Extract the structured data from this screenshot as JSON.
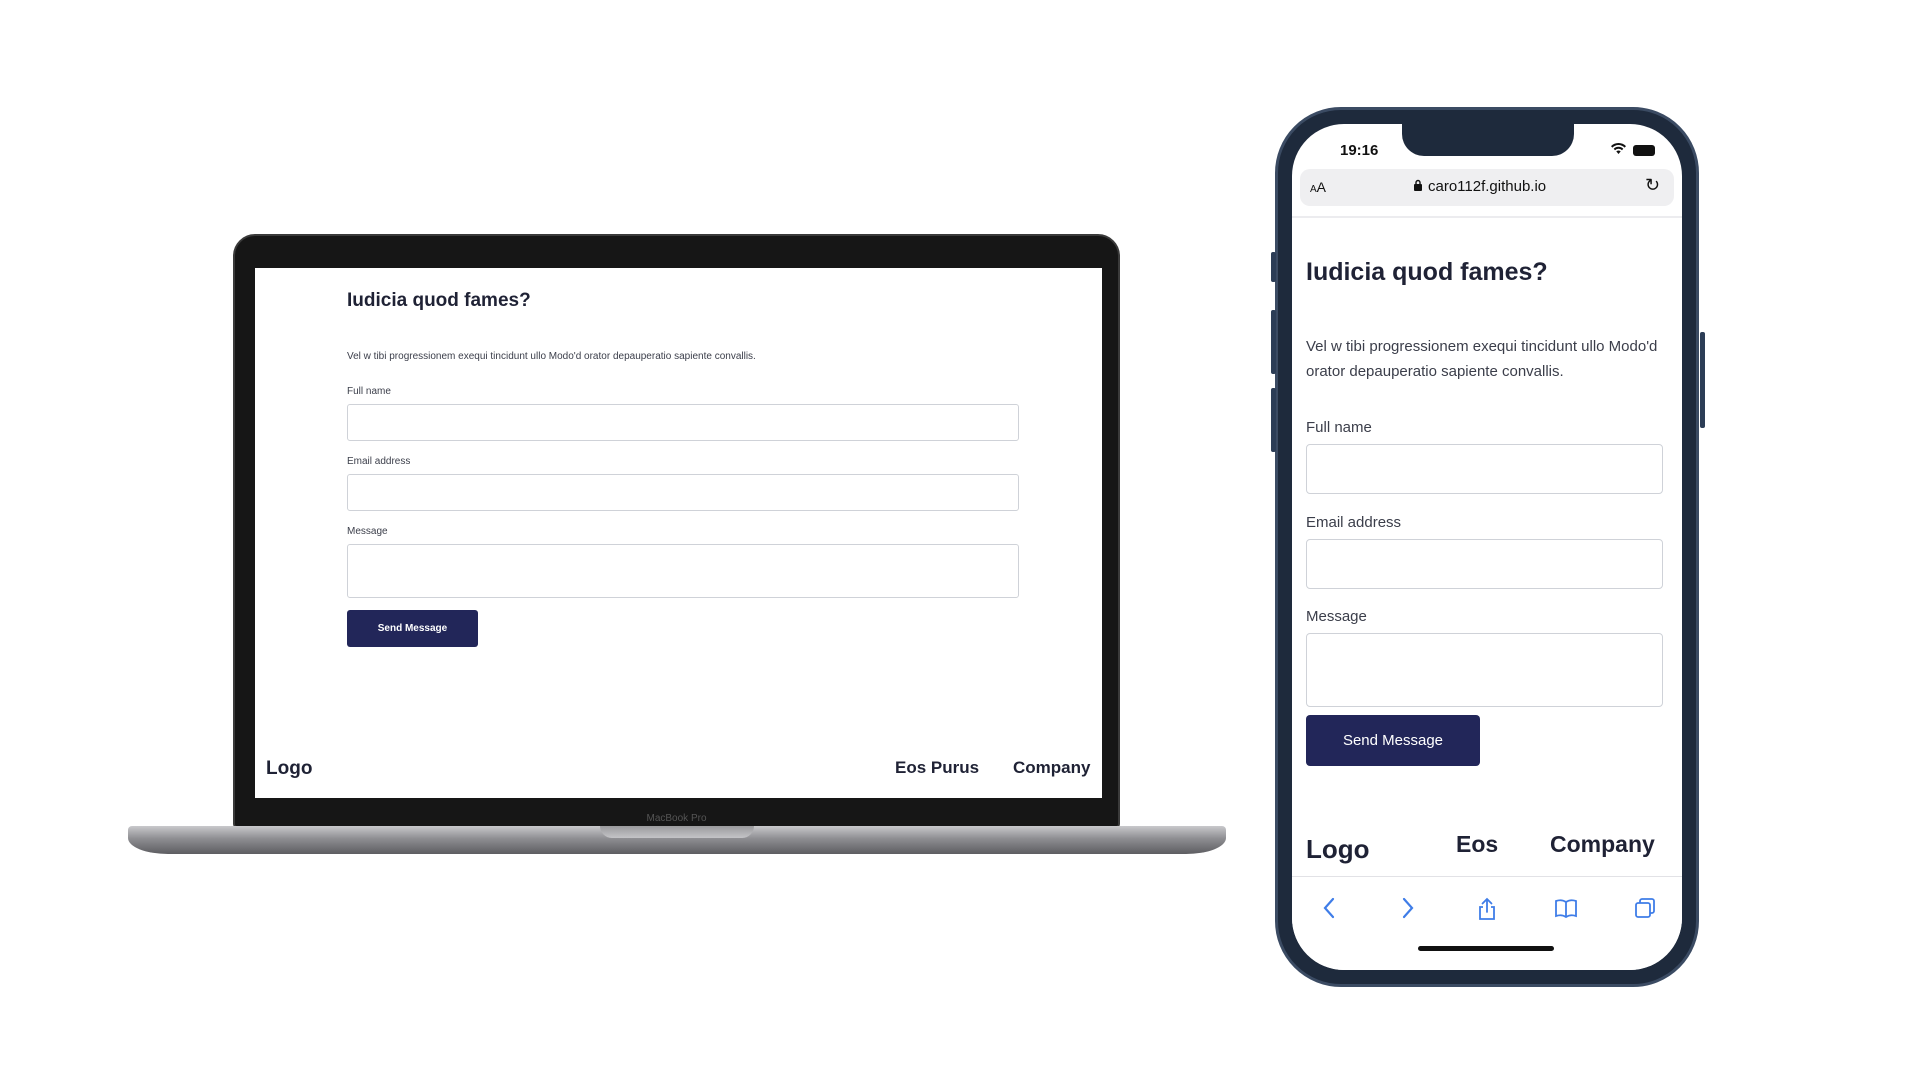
{
  "laptop": {
    "device_label": "MacBook Pro",
    "page": {
      "title": "Iudicia quod fames?",
      "text": "Vel w tibi progressionem exequi tincidunt ullo Modo'd orator depauperatio sapiente convallis.",
      "full_name_label": "Full name",
      "email_label": "Email address",
      "message_label": "Message",
      "button_label": "Send Message",
      "footer": {
        "logo": "Logo",
        "link1": "Eos Purus",
        "link2": "Company"
      }
    }
  },
  "phone": {
    "status": {
      "time": "19:16",
      "wifi_icon": "wifi-icon",
      "battery_icon": "battery-icon"
    },
    "url_bar": {
      "text_size": "AA",
      "url": "caro112f.github.io",
      "lock_icon": "lock-icon",
      "reload_icon": "reload-icon"
    },
    "page": {
      "title": "Iudicia quod fames?",
      "text": "Vel w tibi progressionem exequi tincidunt ullo Modo'd orator depauperatio sapiente convallis.",
      "full_name_label": "Full name",
      "email_label": "Email address",
      "message_label": "Message",
      "button_label": "Send Message",
      "footer": {
        "logo": "Logo",
        "link1": "Eos",
        "link2": "Company"
      }
    },
    "toolbar": {
      "back_icon": "back-icon",
      "forward_icon": "forward-icon",
      "share_icon": "share-icon",
      "bookmarks_icon": "bookmarks-icon",
      "tabs_icon": "tabs-icon"
    }
  },
  "colors": {
    "button_bg": "#222659",
    "heading": "#1f2235",
    "safari_accent": "#3f7de8"
  }
}
